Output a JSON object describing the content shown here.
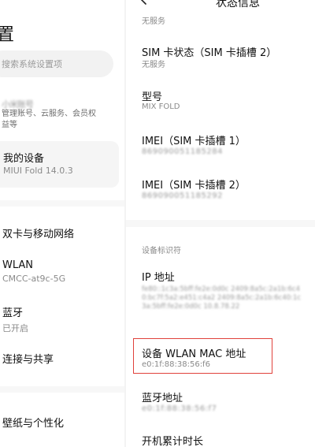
{
  "left": {
    "title": "置",
    "search_placeholder": "搜索系统设置项",
    "account": {
      "name": "小米账号",
      "description": "管理账号、云服务、会员权益等"
    },
    "my_device": {
      "title": "我的设备",
      "subtitle": "MIUI Fold 14.0.3"
    },
    "items": [
      {
        "label": "双卡与移动网络",
        "sub": ""
      },
      {
        "label": "WLAN",
        "sub": "CMCC-at9c-5G"
      },
      {
        "label": "蓝牙",
        "sub": "已开启"
      },
      {
        "label": "连接与共享",
        "sub": ""
      },
      {
        "label": "壁纸与个性化",
        "sub": ""
      }
    ]
  },
  "right": {
    "header_title": "状态信息",
    "top_value": "无服务",
    "sim_status": {
      "label": "SIM 卡状态（SIM 卡插槽 2）",
      "value": "无服务"
    },
    "model": {
      "label": "型号",
      "value": "MIX FOLD"
    },
    "imei1": {
      "label": "IMEI（SIM 卡插槽 1）",
      "value": "869090051185284"
    },
    "imei2": {
      "label": "IMEI（SIM 卡插槽 2）",
      "value": "869090051185292"
    },
    "section_caption": "设备标识符",
    "ip": {
      "label": "IP 地址",
      "value": "fe80::1c3a:5bff:fe2e:0d0c 2409:8a5c:2a1b:6c40:bc7f:5a2:e451:c4a2 2409:8a5c:2a1b:6c40:1c3a:5bff:fe2e:0d0c 10.8.78.22"
    },
    "wlan_mac": {
      "label": "设备 WLAN MAC 地址",
      "value": "e0:1f:88:38:56:f6"
    },
    "bt_address": {
      "label": "蓝牙地址",
      "value": "e0:1f:88:38:56:f7"
    },
    "uptime": {
      "label": "开机累计时长"
    }
  },
  "colors": {
    "highlight": "#e0413b",
    "card_bg": "#f5f5f5",
    "secondary_text": "#8a8a8a"
  }
}
